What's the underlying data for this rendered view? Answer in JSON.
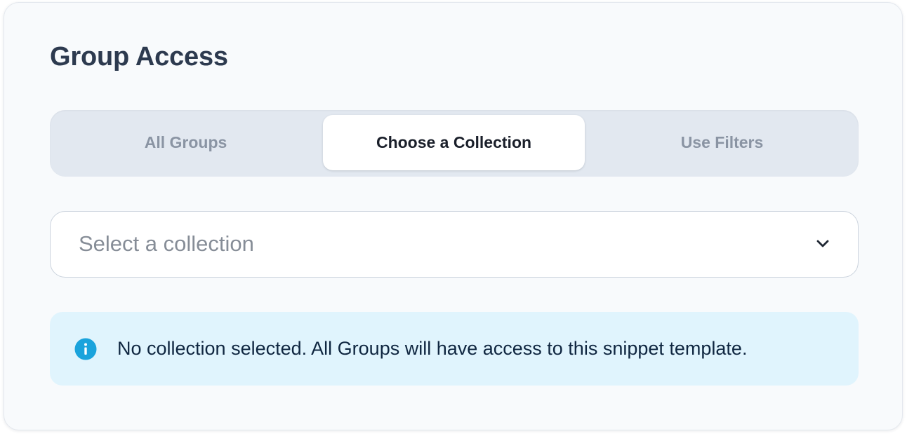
{
  "panel": {
    "title": "Group Access"
  },
  "tabs": [
    {
      "label": "All Groups",
      "active": false
    },
    {
      "label": "Choose a Collection",
      "active": true
    },
    {
      "label": "Use Filters",
      "active": false
    }
  ],
  "collection_select": {
    "placeholder": "Select a collection",
    "icon": "chevron-down-icon"
  },
  "info_banner": {
    "icon": "info-icon",
    "message": "No collection selected. All Groups will have access to this snippet template."
  },
  "colors": {
    "card_background": "#f8fafc",
    "title_text": "#2d3a4f",
    "segmented_track": "#e2e8f0",
    "active_tab": "#ffffff",
    "inactive_tab_text": "#8a94a3",
    "info_background": "#e0f4fd",
    "info_icon": "#1aa3dc"
  }
}
